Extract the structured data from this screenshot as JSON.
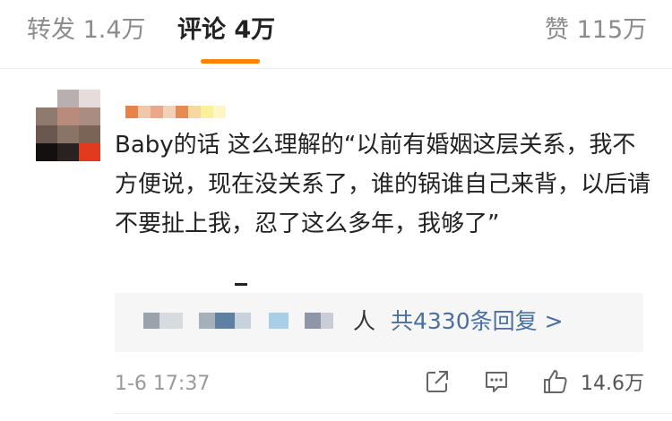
{
  "tabs": {
    "repost": "转发 1.4万",
    "comments": "评论 4万",
    "likes": "赞 115万"
  },
  "accent_color": "#ff8200",
  "comment": {
    "text": "Baby的话 这么理解的“以前有婚姻这层关系，我不方便说，现在没关系了，谁的锅谁自己来背，以后请不要扯上我，忍了这么多年，我够了”",
    "reply_suffix": "人",
    "reply_count_text": "共4330条回复 >",
    "timestamp": "1-6 17:37",
    "like_count": "14.6万"
  },
  "icons": [
    "share-icon",
    "comment-icon",
    "like-icon"
  ],
  "link_color": "#4b6fa0"
}
